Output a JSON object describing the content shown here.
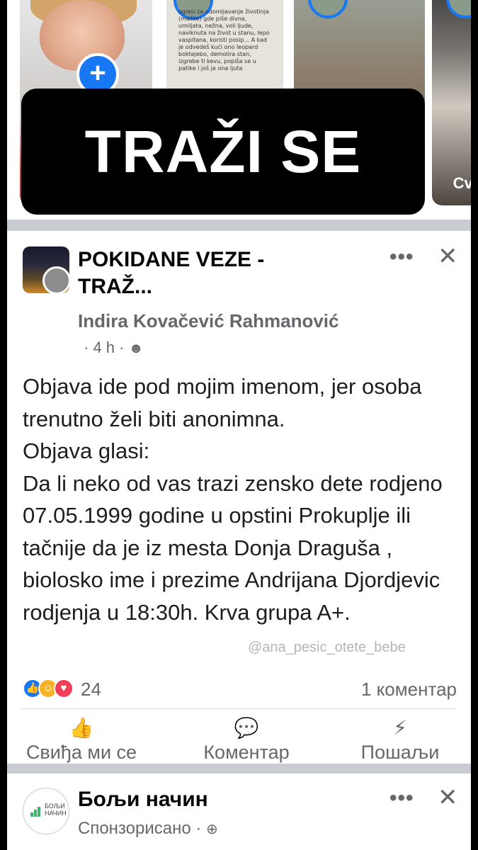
{
  "banner": {
    "text": "TRAŽI SE"
  },
  "stories": {
    "story2_text": "oglasi za udomljavanje životinja (mačke) gde piše divna, umiljata, nežna, voli ljude, naviknuta na život u stanu, lepo vaspitana, koristi posip... A kad je odvedeš kući ono leopard boktejebo, demolira stan, izgrebe ti kevu, popiša se u patike i još je ona ljuta",
    "story4_label": "Cvij",
    "add_icon": "plus-icon"
  },
  "post": {
    "group_name": "POKIDANE VEZE - TRAŽ...",
    "author": "Indira Kovačević Rahmanović",
    "time": "· 4 h ·",
    "privacy_icon": "group-icon",
    "more_icon": "•••",
    "close_icon": "✕",
    "body": [
      "Objava ide pod mojim imenom, jer osoba trenutno želi biti anonimna.",
      "Objava glasi:",
      "Da li neko od vas trazi zensko dete rodjeno 07.05.1999 godine u opstini Prokuplje ili tačnije da je iz mesta Donja Draguša , biolosko ime i prezime Andrijana Djordjevic rodjenja u 18:30h. Krva grupa A+."
    ],
    "watermark": "@ana_pesic_otete_bebe",
    "reaction_count": "24",
    "comment_count": "1 коментар",
    "actions": {
      "like": "Свиђа ми се",
      "comment": "Коментар",
      "share": "Пошаљи"
    }
  },
  "sponsored": {
    "name": "Бољи начин",
    "label": "Спонзорисано ·",
    "logo_text": "БОЉИ НАЧИН",
    "more_icon": "•••",
    "close_icon": "✕"
  },
  "colors": {
    "accent": "#1877f2",
    "secondary_text": "#65676b",
    "divider": "#c9ccd1"
  }
}
